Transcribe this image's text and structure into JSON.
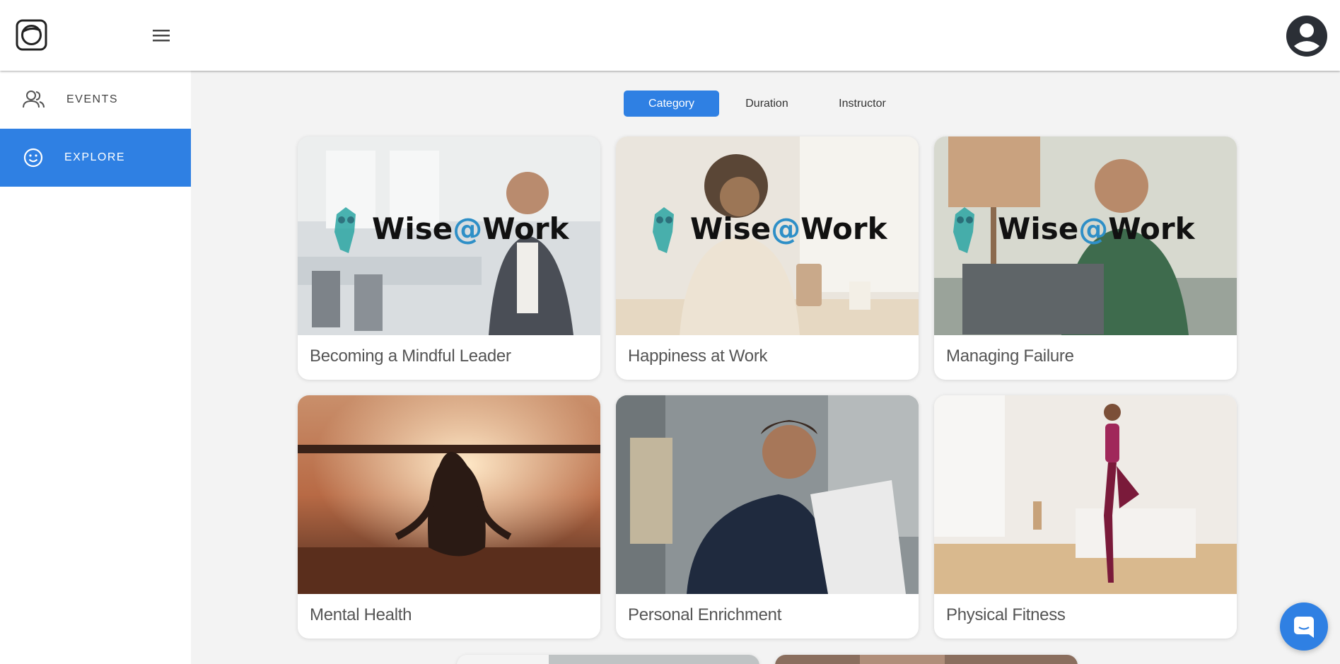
{
  "header": {
    "logo": "camera-logo-icon",
    "menu_icon": "hamburger-menu-icon",
    "avatar_icon": "user-avatar-icon"
  },
  "sidebar": {
    "items": [
      {
        "label": "EVENTS",
        "icon": "people-icon",
        "active": false
      },
      {
        "label": "EXPLORE",
        "icon": "smiley-icon",
        "active": true
      }
    ]
  },
  "filters": {
    "options": [
      "Category",
      "Duration",
      "Instructor"
    ],
    "selected": "Category"
  },
  "cards": [
    {
      "title": "Becoming a Mindful Leader",
      "overlay": "Wise@Work"
    },
    {
      "title": "Happiness at Work",
      "overlay": "Wise@Work"
    },
    {
      "title": "Managing Failure",
      "overlay": "Wise@Work"
    },
    {
      "title": "Mental Health"
    },
    {
      "title": "Personal Enrichment"
    },
    {
      "title": "Physical Fitness"
    }
  ],
  "colors": {
    "accent": "#2f80e3",
    "background": "#f3f3f3",
    "text": "#555555"
  },
  "chat": {
    "icon": "chat-bubble-icon"
  }
}
